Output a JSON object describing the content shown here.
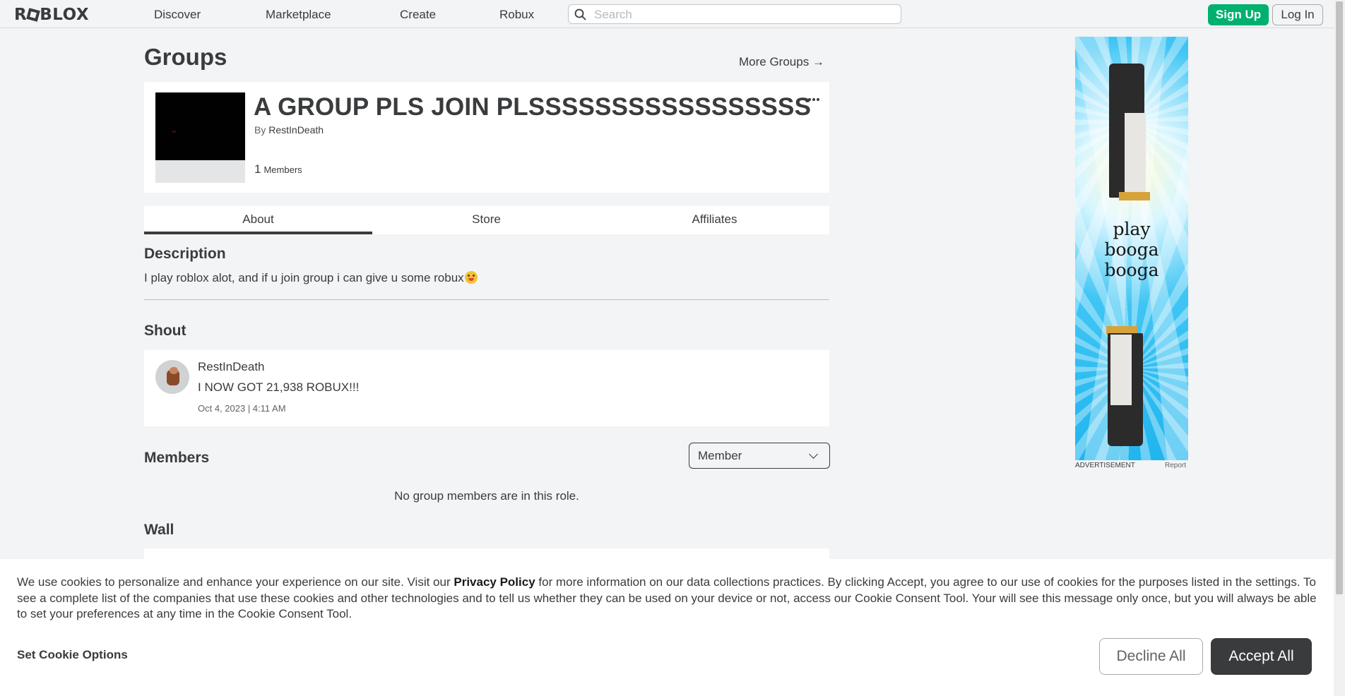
{
  "nav": {
    "logo": "ROBLOX",
    "links": [
      "Discover",
      "Marketplace",
      "Create",
      "Robux"
    ],
    "search_placeholder": "Search",
    "signup_label": "Sign Up",
    "login_label": "Log In"
  },
  "page": {
    "title": "Groups",
    "more_groups": "More Groups →"
  },
  "group": {
    "name": "A GROUP PLS JOIN PLSSSSSSSSSSSSSSSSS",
    "by_label": "By",
    "owner": "RestInDeath",
    "member_count": "1",
    "members_label": "Members"
  },
  "tabs": [
    "About",
    "Store",
    "Affiliates"
  ],
  "active_tab": "About",
  "description": {
    "title": "Description",
    "text": "I play roblox alot, and if u join group i can give u some robux"
  },
  "shout": {
    "title": "Shout",
    "user": "RestInDeath",
    "body": "I NOW GOT 21,938 ROBUX!!!",
    "date": "Oct 4, 2023 | 4:11 AM"
  },
  "members": {
    "title": "Members",
    "role_selected": "Member",
    "empty_note": "No group members are in this role."
  },
  "wall": {
    "title": "Wall"
  },
  "ad": {
    "text_lines": [
      "play",
      "booga",
      "booga"
    ],
    "label": "ADVERTISEMENT",
    "report": "Report"
  },
  "cookie": {
    "text_before": "We use cookies to personalize and enhance your experience on our site. Visit our ",
    "privacy_link": "Privacy Policy",
    "text_after": " for more information on our data collections practices. By clicking Accept, you agree to our use of cookies for the purposes listed in the settings. To see a complete list of the companies that use these cookies and other technologies and to tell us whether they can be used on your device or not, access our Cookie Consent Tool. Your will see this message only once, but you will always be able to set your preferences at any time in the Cookie Consent Tool.",
    "options_label": "Set Cookie Options",
    "decline_label": "Decline All",
    "accept_label": "Accept All"
  },
  "colors": {
    "signup": "#00b06f",
    "accept": "#393b3d",
    "background": "#f2f4f5"
  }
}
